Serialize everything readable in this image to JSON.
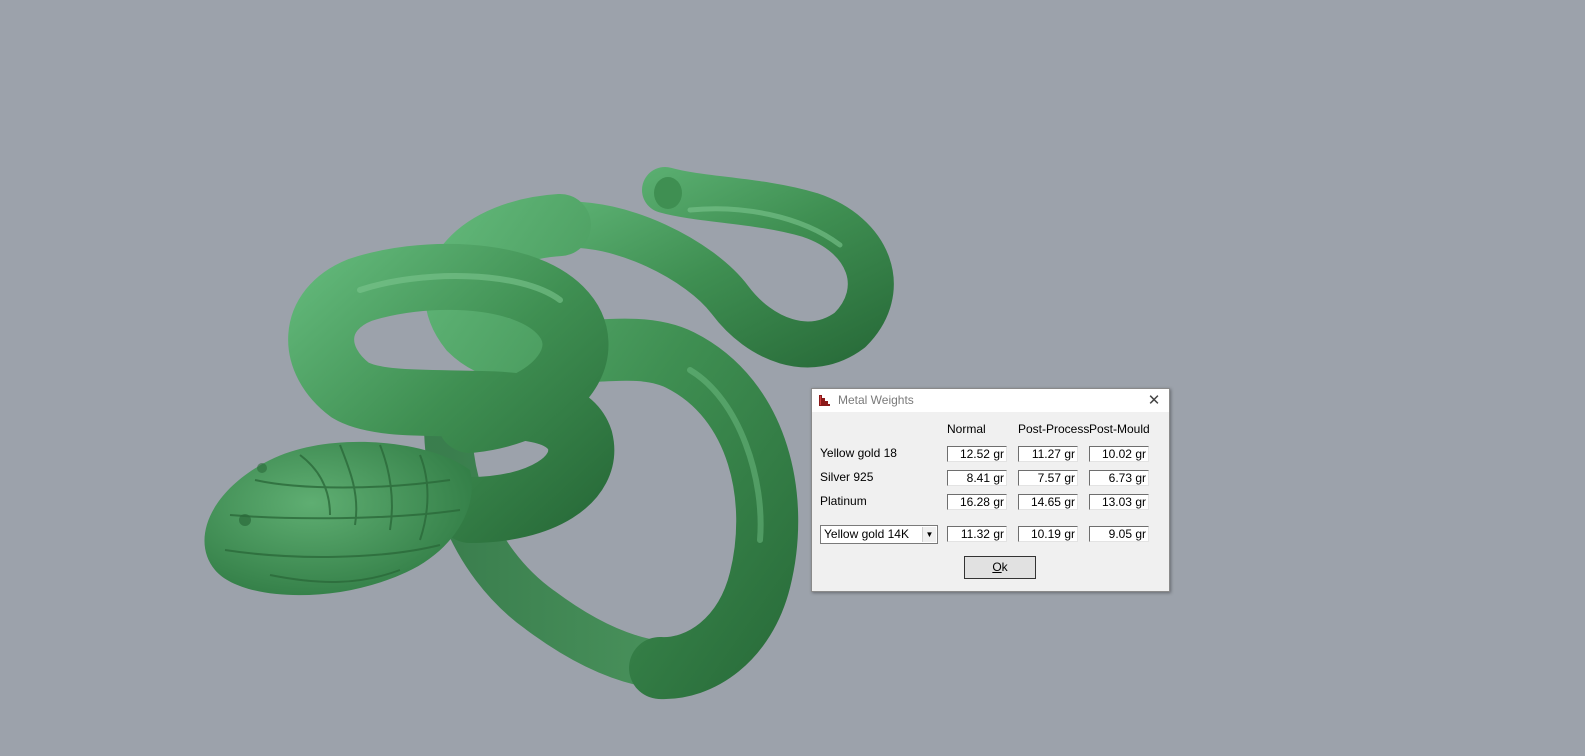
{
  "viewport": {
    "background_color": "#9ca2ab",
    "model_color": "#3f8f52",
    "model_subject": "snake ring 3D model"
  },
  "dialog": {
    "title": "Metal Weights",
    "icon": "app-logo-icon",
    "close_icon": "close-icon",
    "close_symbol": "✕",
    "columns": [
      "Normal",
      "Post-Process",
      "Post-Mould"
    ],
    "rows": [
      {
        "label": "Yellow gold 18",
        "values": [
          "12.52 gr",
          "11.27 gr",
          "10.02 gr"
        ]
      },
      {
        "label": "Silver 925",
        "values": [
          "8.41 gr",
          "7.57 gr",
          "6.73 gr"
        ]
      },
      {
        "label": "Platinum",
        "values": [
          "16.28 gr",
          "14.65 gr",
          "13.03 gr"
        ]
      }
    ],
    "custom_row": {
      "selected_metal": "Yellow gold 14K",
      "values": [
        "11.32 gr",
        "10.19 gr",
        "9.05 gr"
      ]
    },
    "ok_label_prefix": "",
    "ok_label_underlined": "O",
    "ok_label_suffix": "k"
  }
}
